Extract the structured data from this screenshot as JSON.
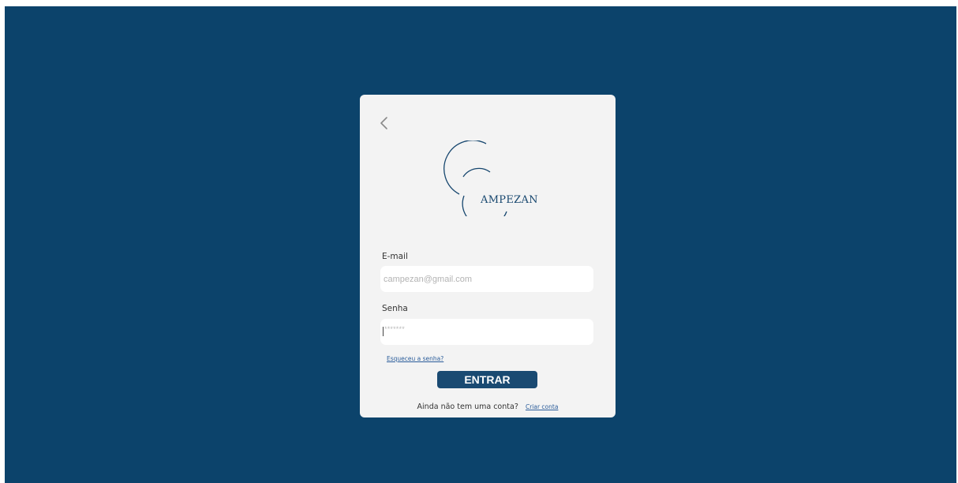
{
  "logo": {
    "brand_text": "AMPEZAN",
    "icon": "campezan-logo"
  },
  "nav": {
    "back_icon": "chevron-left-icon"
  },
  "form": {
    "email_label": "E-mail",
    "email_placeholder": "campezan@gmail.com",
    "email_value": "",
    "password_label": "Senha",
    "password_value": "*******",
    "forgot_password": "Esqueceu a senha?",
    "submit_label": "ENTRAR",
    "signup_prompt": "Ainda não tem uma conta?",
    "signup_link": "Criar conta"
  },
  "colors": {
    "background": "#0c436b",
    "card": "#f3f3f3",
    "button": "#1a4a72",
    "link": "#2a5c9a",
    "logo": "#16466e"
  }
}
